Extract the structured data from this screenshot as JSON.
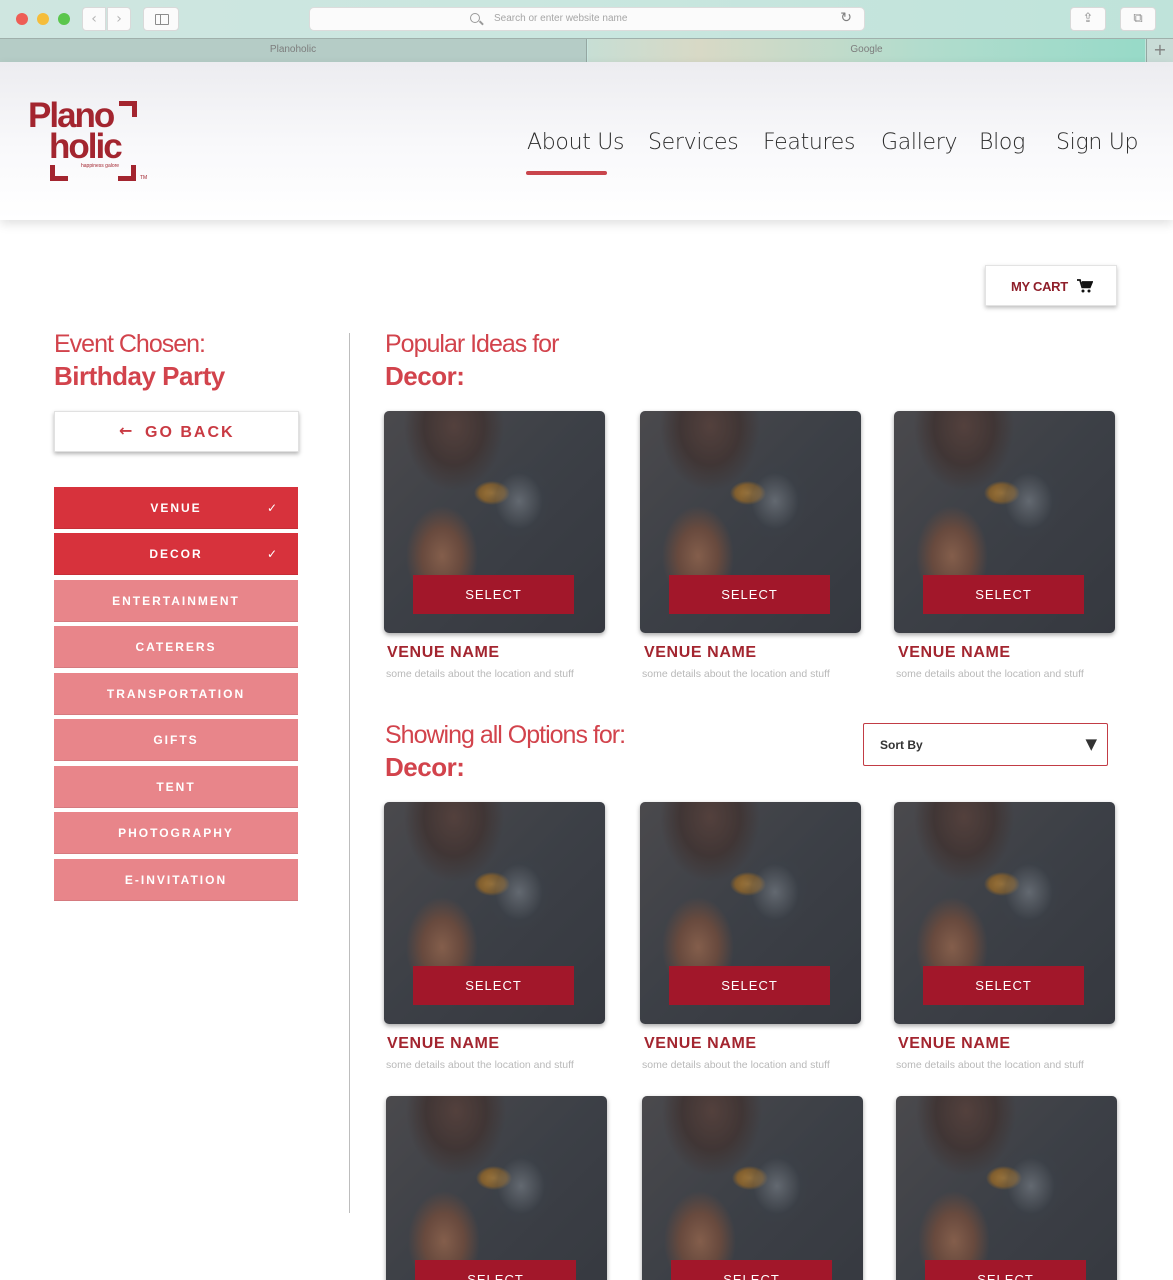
{
  "browser": {
    "url_placeholder": "Search or enter website name",
    "tabs": [
      {
        "label": "Planoholic"
      },
      {
        "label": "Google"
      }
    ],
    "new_tab_label": "+"
  },
  "site": {
    "logo": {
      "line1": "Plano",
      "line2": "holic",
      "tagline": "happiness galore",
      "tm": "TM"
    },
    "nav": [
      {
        "label": "About Us",
        "active": true
      },
      {
        "label": "Services"
      },
      {
        "label": "Features"
      },
      {
        "label": "Gallery"
      },
      {
        "label": "Blog"
      },
      {
        "label": "Sign Up"
      }
    ],
    "accent_color": "#d2434c",
    "brand_color": "#a3252f"
  },
  "cart": {
    "label": "MY CART",
    "icon": "cart-icon"
  },
  "event": {
    "label": "Event Chosen:",
    "value": "Birthday Party"
  },
  "go_back": {
    "label": "GO BACK",
    "icon": "arrow-left-icon"
  },
  "categories": [
    {
      "label": "VENUE",
      "active": true,
      "checked": true
    },
    {
      "label": "DECOR",
      "active": true,
      "checked": true
    },
    {
      "label": "ENTERTAINMENT",
      "active": false
    },
    {
      "label": "CATERERS",
      "active": false
    },
    {
      "label": "TRANSPORTATION",
      "active": false
    },
    {
      "label": "GIFTS",
      "active": false
    },
    {
      "label": "TENT",
      "active": false
    },
    {
      "label": "PHOTOGRAPHY",
      "active": false
    },
    {
      "label": "E-INVITATION",
      "active": false
    }
  ],
  "popular": {
    "label": "Popular Ideas for",
    "category": "Decor:",
    "cards": [
      {
        "select": "SELECT",
        "name": "VENUE NAME",
        "desc": "some details about the location and stuff"
      },
      {
        "select": "SELECT",
        "name": "VENUE NAME",
        "desc": "some details about the location and stuff"
      },
      {
        "select": "SELECT",
        "name": "VENUE NAME",
        "desc": "some details about the location and stuff"
      }
    ]
  },
  "all_options": {
    "label": "Showing all Options for:",
    "category": "Decor:",
    "sort": {
      "label": "Sort By"
    },
    "cards": [
      {
        "select": "SELECT",
        "name": "VENUE NAME",
        "desc": "some details about the location and stuff"
      },
      {
        "select": "SELECT",
        "name": "VENUE NAME",
        "desc": "some details about the location and stuff"
      },
      {
        "select": "SELECT",
        "name": "VENUE NAME",
        "desc": "some details about the location and stuff"
      },
      {
        "select": "SELECT"
      },
      {
        "select": "SELECT"
      },
      {
        "select": "SELECT"
      }
    ]
  }
}
